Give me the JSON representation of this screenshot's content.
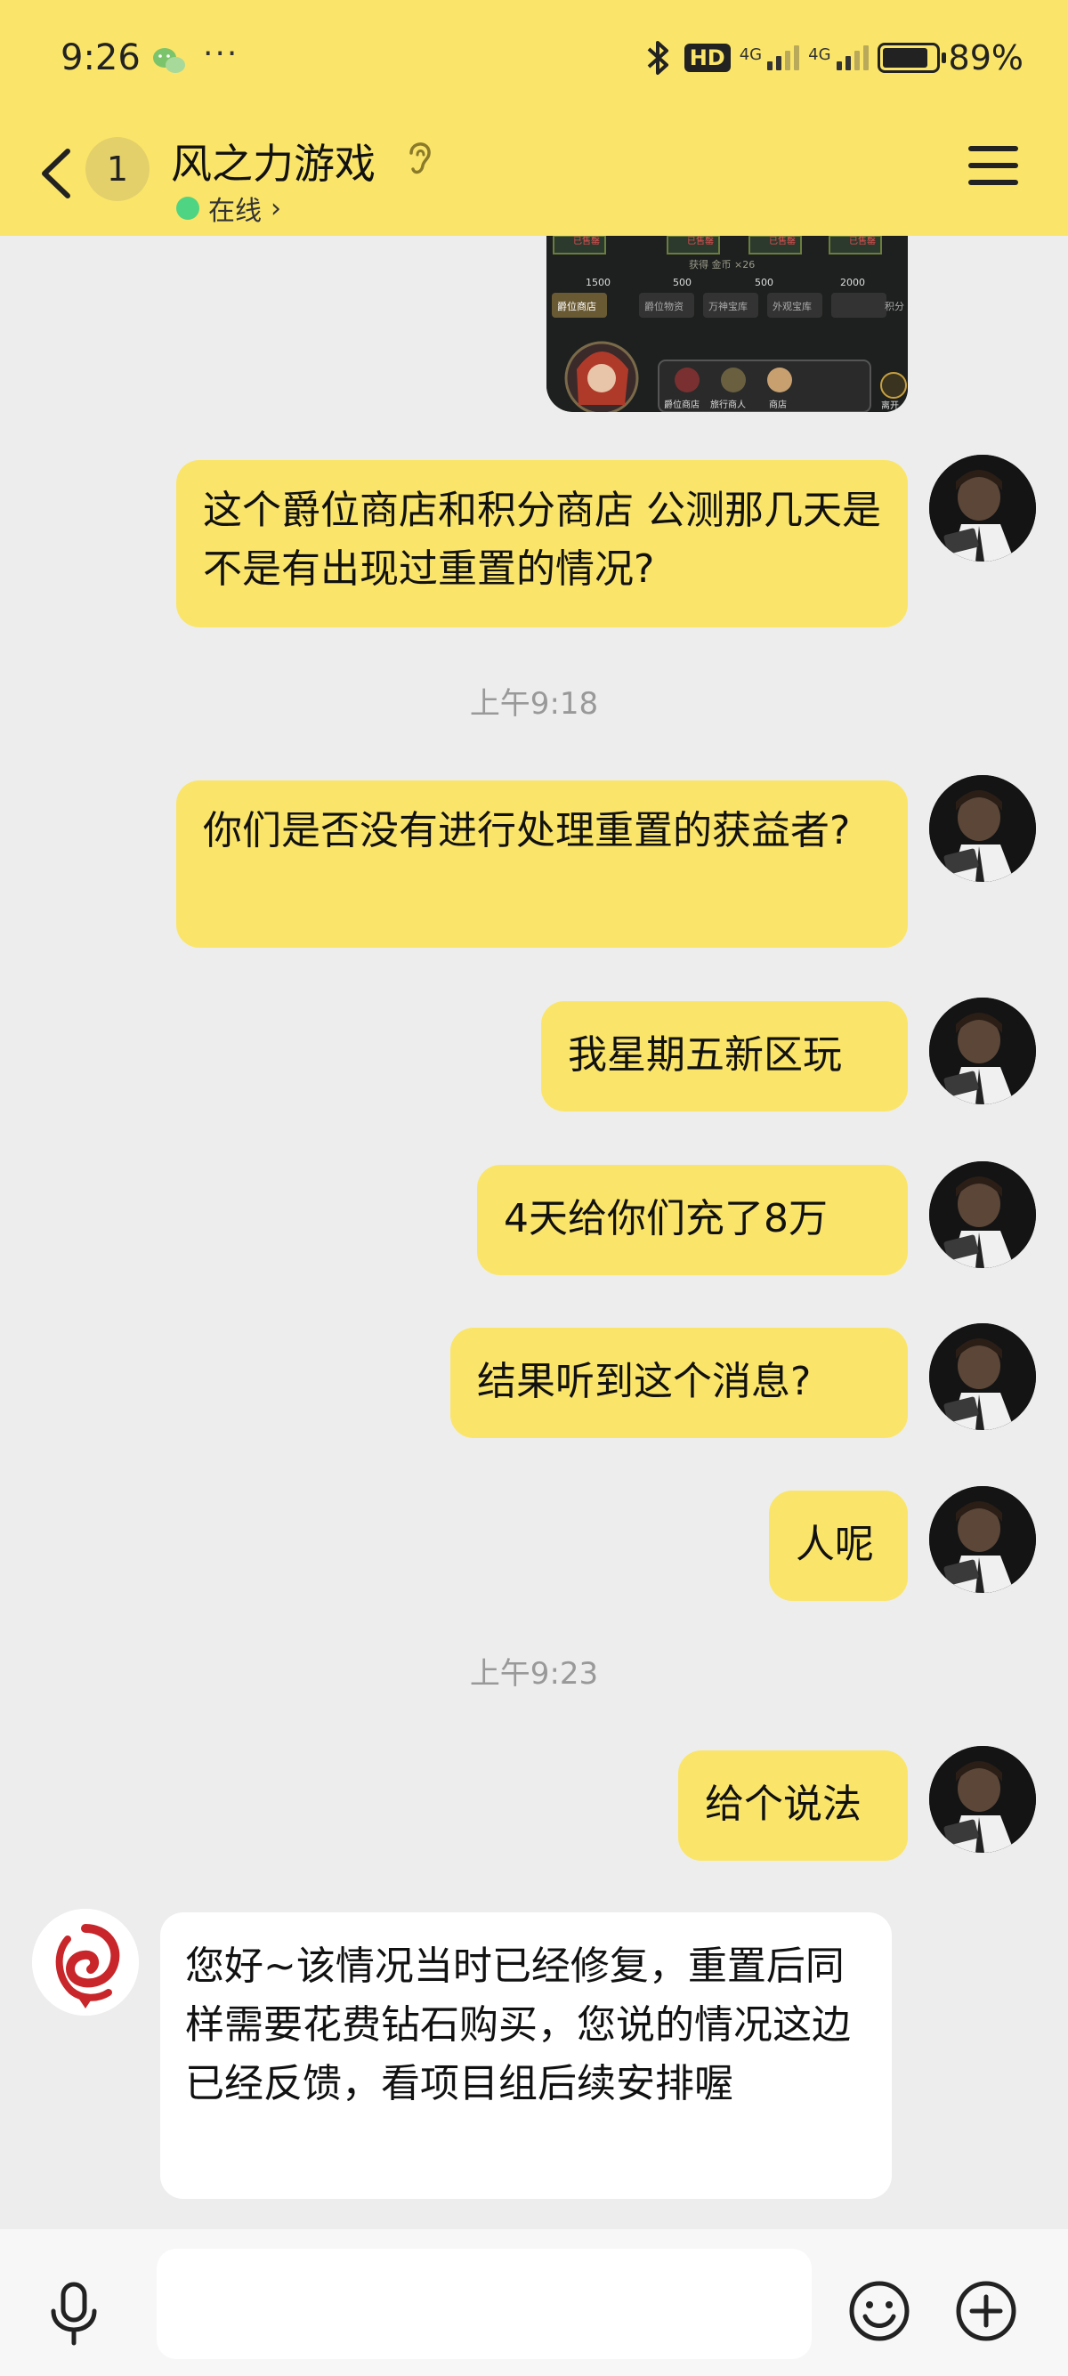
{
  "status_bar": {
    "time": "9:26",
    "more": "···",
    "hd_label": "HD",
    "network_1": "4G",
    "network_2": "4G",
    "battery_level": 0.89,
    "battery_text": "89%"
  },
  "header": {
    "back_label": "",
    "unread_count": "1",
    "title": "风之力游戏",
    "status": "在线",
    "status_chevron": "›"
  },
  "colors": {
    "accent": "#fae56a",
    "background": "#ededed",
    "online_dot": "#4fd483"
  },
  "game_screenshot": {
    "tabs": [
      "爵位商店",
      "爵位物资",
      "万神宝库",
      "外观宝库",
      "积分"
    ],
    "prices": [
      "1500",
      "500",
      "500",
      "2000"
    ],
    "hint": "获得 金币 ×26",
    "npc_labels": [
      "爵位商店",
      "旅行商人",
      "商店"
    ],
    "badges": [
      "已售罄",
      "已售罄",
      "已售罄",
      "已售罄"
    ],
    "corner_label": "离开"
  },
  "messages": [
    {
      "type": "sent",
      "text": "这个爵位商店和积分商店 公测那几天是不是有出现过重置的情况?"
    },
    {
      "type": "time",
      "text": "上午9:18"
    },
    {
      "type": "sent",
      "text": "你们是否没有进行处理重置的获益者?"
    },
    {
      "type": "sent",
      "text": "我星期五新区玩"
    },
    {
      "type": "sent",
      "text": "4天给你们充了8万"
    },
    {
      "type": "sent",
      "text": "结果听到这个消息?"
    },
    {
      "type": "sent",
      "text": "人呢"
    },
    {
      "type": "time",
      "text": "上午9:23"
    },
    {
      "type": "sent",
      "text": "给个说法"
    },
    {
      "type": "received",
      "text": "您好~该情况当时已经修复，重置后同样需要花费钻石购买，您说的情况这边已经反馈，看项目组后续安排喔"
    }
  ],
  "input_bar": {
    "placeholder": ""
  }
}
